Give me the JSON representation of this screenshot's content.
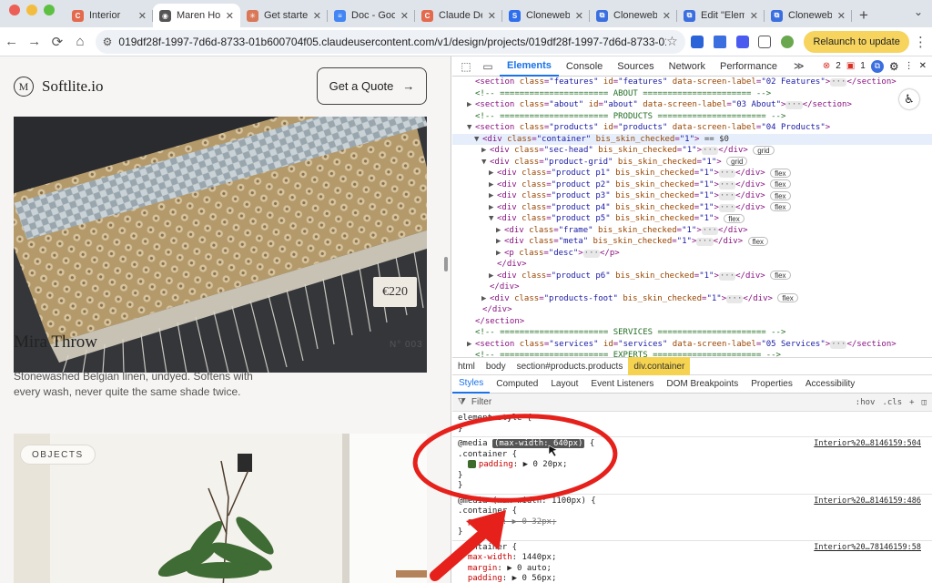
{
  "tabs": [
    {
      "title": "Interior",
      "fav_color": "#e46a4e",
      "fav_glyph": "C"
    },
    {
      "title": "Maren Holt",
      "fav_color": "#555555",
      "fav_glyph": "◉"
    },
    {
      "title": "Get started",
      "fav_color": "#d97757",
      "fav_glyph": "✳"
    },
    {
      "title": "Doc - Goog",
      "fav_color": "#4285f4",
      "fav_glyph": "≡"
    },
    {
      "title": "Claude Des",
      "fav_color": "#e46a4e",
      "fav_glyph": "C"
    },
    {
      "title": "ClonewebX",
      "fav_color": "#2f6fed",
      "fav_glyph": "S"
    },
    {
      "title": "ClonewebX",
      "fav_color": "#3b6fe0",
      "fav_glyph": "⧉"
    },
    {
      "title": "Edit \"Eleme",
      "fav_color": "#3b6fe0",
      "fav_glyph": "⧉"
    },
    {
      "title": "ClonewebX",
      "fav_color": "#3b6fe0",
      "fav_glyph": "⧉"
    }
  ],
  "active_tab": 1,
  "url": "019df28f-1997-7d6d-8733-01b600704f05.claudeusercontent.com/v1/design/projects/019df28f-1997-7d6d-8733-01b600...",
  "relaunch_label": "Relaunch to update",
  "site": {
    "logo_letter": "M",
    "brand": "Softlite.io",
    "quote_label": "Get a Quote",
    "price": "€220",
    "product_name": "Mira Throw",
    "product_number": "N° 003",
    "product_desc": "Stonewashed Belgian linen, undyed. Softens with every wash, never quite the same shade twice.",
    "badge": "OBJECTS"
  },
  "devtools": {
    "tabs": [
      "Elements",
      "Console",
      "Sources",
      "Network",
      "Performance"
    ],
    "errors": "2",
    "warnings": "1",
    "breadcrumbs": [
      "html",
      "body",
      "section#products.products",
      "div.container"
    ],
    "style_tabs": [
      "Styles",
      "Computed",
      "Layout",
      "Event Listeners",
      "DOM Breakpoints",
      "Properties",
      "Accessibility"
    ],
    "filter_label": "Filter",
    "filter_right": [
      ":hov",
      ".cls"
    ],
    "tree": [
      {
        "i": 2,
        "t": "<section class=\"features\" id=\"features\" data-screen-label=\"02 Features\">",
        "tail": "</section>"
      },
      {
        "i": 2,
        "t": "<!-- ====================== ABOUT ====================== -->",
        "c": 1
      },
      {
        "i": 2,
        "t": "<section class=\"about\" id=\"about\" data-screen-label=\"03 About\">",
        "tail": "</section>",
        "tri": "▶"
      },
      {
        "i": 2,
        "t": "<!-- ====================== PRODUCTS ====================== -->",
        "c": 1
      },
      {
        "i": 2,
        "t": "<section class=\"products\" id=\"products\" data-screen-label=\"04 Products\">",
        "tri": "▼"
      },
      {
        "i": 3,
        "t": "<div class=\"container\" bis_skin_checked=\"1\"> == $0",
        "tri": "▼",
        "sel": 1
      },
      {
        "i": 4,
        "t": "<div class=\"sec-head\" bis_skin_checked=\"1\">",
        "tail": "</div>",
        "pill": "grid",
        "tri": "▶"
      },
      {
        "i": 4,
        "t": "<div class=\"product-grid\" bis_skin_checked=\"1\">",
        "pill": "grid",
        "tri": "▼"
      },
      {
        "i": 5,
        "t": "<div class=\"product p1\" bis_skin_checked=\"1\">",
        "tail": "</div>",
        "pill": "flex",
        "tri": "▶"
      },
      {
        "i": 5,
        "t": "<div class=\"product p2\" bis_skin_checked=\"1\">",
        "tail": "</div>",
        "pill": "flex",
        "tri": "▶"
      },
      {
        "i": 5,
        "t": "<div class=\"product p3\" bis_skin_checked=\"1\">",
        "tail": "</div>",
        "pill": "flex",
        "tri": "▶"
      },
      {
        "i": 5,
        "t": "<div class=\"product p4\" bis_skin_checked=\"1\">",
        "tail": "</div>",
        "pill": "flex",
        "tri": "▶"
      },
      {
        "i": 5,
        "t": "<div class=\"product p5\" bis_skin_checked=\"1\">",
        "pill": "flex",
        "tri": "▼"
      },
      {
        "i": 6,
        "t": "<div class=\"frame\" bis_skin_checked=\"1\">",
        "tail": "</div>",
        "tri": "▶"
      },
      {
        "i": 6,
        "t": "<div class=\"meta\" bis_skin_checked=\"1\">",
        "tail": "</div>",
        "pill": "flex",
        "tri": "▶"
      },
      {
        "i": 6,
        "t": "<p class=\"desc\">",
        "tail": "</p>",
        "tri": "▶"
      },
      {
        "i": 5,
        "t": "</div>"
      },
      {
        "i": 5,
        "t": "<div class=\"product p6\" bis_skin_checked=\"1\">",
        "tail": "</div>",
        "pill": "flex",
        "tri": "▶"
      },
      {
        "i": 4,
        "t": "</div>"
      },
      {
        "i": 4,
        "t": "<div class=\"products-foot\" bis_skin_checked=\"1\">",
        "tail": "</div>",
        "pill": "flex",
        "tri": "▶"
      },
      {
        "i": 3,
        "t": "</div>"
      },
      {
        "i": 2,
        "t": "</section>"
      },
      {
        "i": 2,
        "t": "<!-- ====================== SERVICES ====================== -->",
        "c": 1
      },
      {
        "i": 2,
        "t": "<section class=\"services\" id=\"services\" data-screen-label=\"05 Services\">",
        "tail": "</section>",
        "tri": "▶"
      },
      {
        "i": 2,
        "t": "<!-- ====================== EXPERTS ====================== -->",
        "c": 1
      }
    ],
    "rules": [
      {
        "lines": [
          "element.style {",
          "}"
        ]
      },
      {
        "media": "(max-width: 640px)",
        "src": "Interior%20…8146159:504",
        "lines": [
          ".container {",
          "padding: ▶ 0 20px;",
          "}",
          "}"
        ],
        "checked": 1
      },
      {
        "media": "(max-width: 1100px)",
        "src": "Interior%20…8146159:486",
        "lines": [
          ".container {",
          "padding: ▶ 0 32px;",
          "}"
        ],
        "strike": 1
      },
      {
        "src": "Interior%20…78146159:58",
        "lines": [
          ".container {",
          "max-width: 1440px;",
          "margin: ▶ 0 auto;",
          "padding: ▶ 0 56px;"
        ]
      }
    ]
  }
}
